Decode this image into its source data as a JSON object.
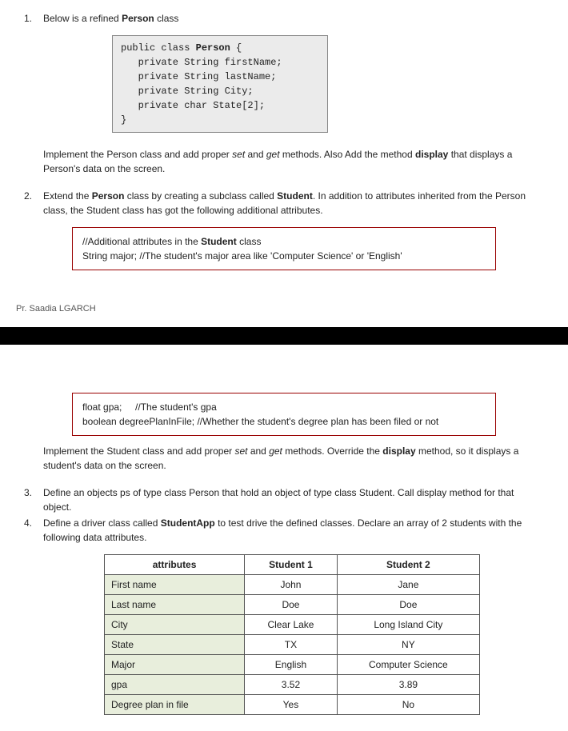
{
  "q1": {
    "num": "1.",
    "intro_before": "Below is a refined ",
    "intro_bold": "Person",
    "intro_after": " class",
    "code_pre": "public class ",
    "code_bold": "Person",
    "code_post": " {\n   private String firstName;\n   private String lastName;\n   private String City;\n   private char State[2];\n}",
    "para_a": "Implement the Person class and add proper ",
    "para_set": "set",
    "para_and": " and ",
    "para_get": "get",
    "para_b": " methods. Also Add the method ",
    "para_disp": "display",
    "para_c": " that displays a Person's data on the screen."
  },
  "q2": {
    "num": "2.",
    "intro_a": "Extend the ",
    "intro_bold1": "Person",
    "intro_b": " class by creating a subclass called ",
    "intro_bold2": "Student",
    "intro_c": ". In addition to attributes inherited from the Person class, the Student class has got the following additional attributes.",
    "box1_a": "//Additional attributes in the ",
    "box1_bold": "Student",
    "box1_b": " class",
    "box1_line2": "String major;  //The student's major area like 'Computer Science' or 'English'"
  },
  "footer": "Pr. Saadia LGARCH",
  "box2": {
    "line1_a": "float gpa;",
    "line1_b": "//The student's gpa",
    "line2": "boolean degreePlanInFile; //Whether the student's degree plan has been filed or not"
  },
  "impl2_a": "Implement the Student class and add proper ",
  "impl2_set": "set",
  "impl2_and": " and ",
  "impl2_get": "get",
  "impl2_b": " methods. Override the ",
  "impl2_disp": "display",
  "impl2_c": " method, so it displays a student's data on the screen.",
  "q3": {
    "num": "3.",
    "text": "Define an objects ps of type class Person that hold an object of type class Student. Call display method for that object."
  },
  "q4": {
    "num": "4.",
    "text_a": "Define a driver class called ",
    "text_bold": "StudentApp",
    "text_b": " to test drive the defined classes. Declare an array of 2 students with the following data attributes."
  },
  "table": {
    "headers": [
      "attributes",
      "Student 1",
      "Student 2"
    ],
    "rows": [
      [
        "First name",
        "John",
        "Jane"
      ],
      [
        "Last name",
        "Doe",
        "Doe"
      ],
      [
        "City",
        "Clear Lake",
        "Long Island City"
      ],
      [
        "State",
        "TX",
        "NY"
      ],
      [
        "Major",
        "English",
        "Computer Science"
      ],
      [
        "gpa",
        "3.52",
        "3.89"
      ],
      [
        "Degree plan in file",
        "Yes",
        "No"
      ]
    ]
  }
}
